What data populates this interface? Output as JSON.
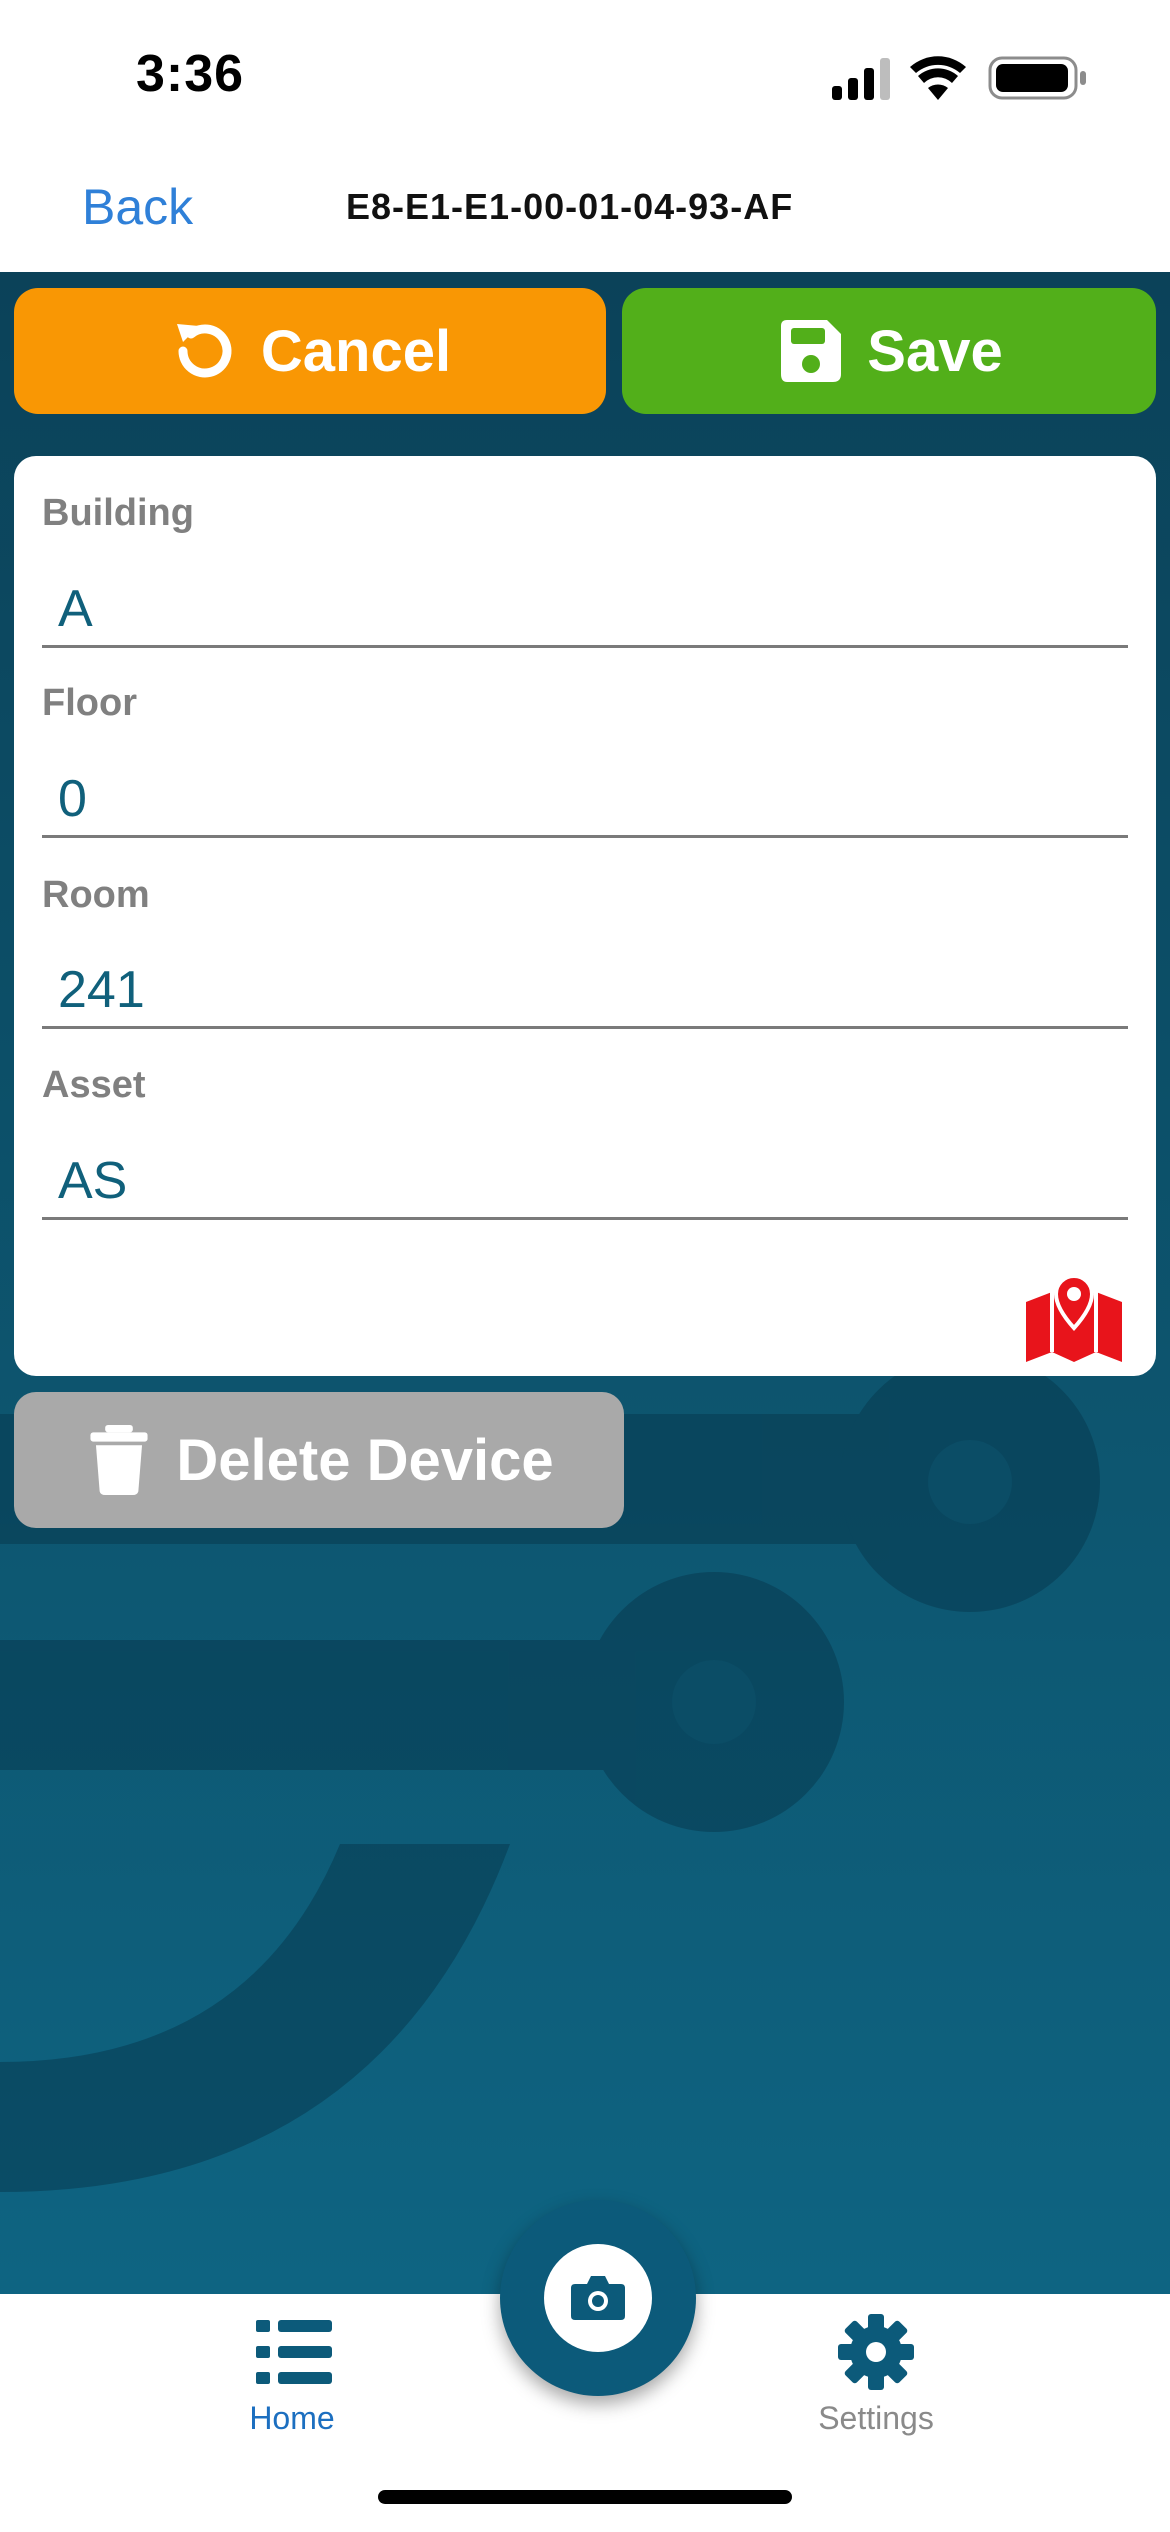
{
  "status_bar": {
    "time": "3:36",
    "icons": [
      "cellular-signal-icon",
      "wifi-icon",
      "battery-icon"
    ]
  },
  "nav": {
    "back_label": "Back",
    "title": "E8-E1-E1-00-01-04-93-AF"
  },
  "actions": {
    "cancel_label": "Cancel",
    "cancel_icon": "undo-icon",
    "cancel_color": "#f99704",
    "save_label": "Save",
    "save_icon": "floppy-disk-icon",
    "save_color": "#52af1a"
  },
  "form": {
    "fields": [
      {
        "label": "Building",
        "value": "A"
      },
      {
        "label": "Floor",
        "value": "0"
      },
      {
        "label": "Room",
        "value": "241"
      },
      {
        "label": "Asset",
        "value": "AS"
      }
    ],
    "map_icon": "map-location-icon",
    "map_icon_color": "#e8141b"
  },
  "delete": {
    "label": "Delete Device",
    "icon": "trash-icon",
    "color": "#a9a9a9"
  },
  "tabs": [
    {
      "label": "Home",
      "icon": "list-icon",
      "active": true
    },
    {
      "label": "Settings",
      "icon": "gear-icon",
      "active": false
    }
  ],
  "camera": {
    "icon": "camera-icon"
  },
  "colors": {
    "accent": "#2f80d8",
    "background_dark": "#0b4259",
    "input_text": "#10607b"
  }
}
